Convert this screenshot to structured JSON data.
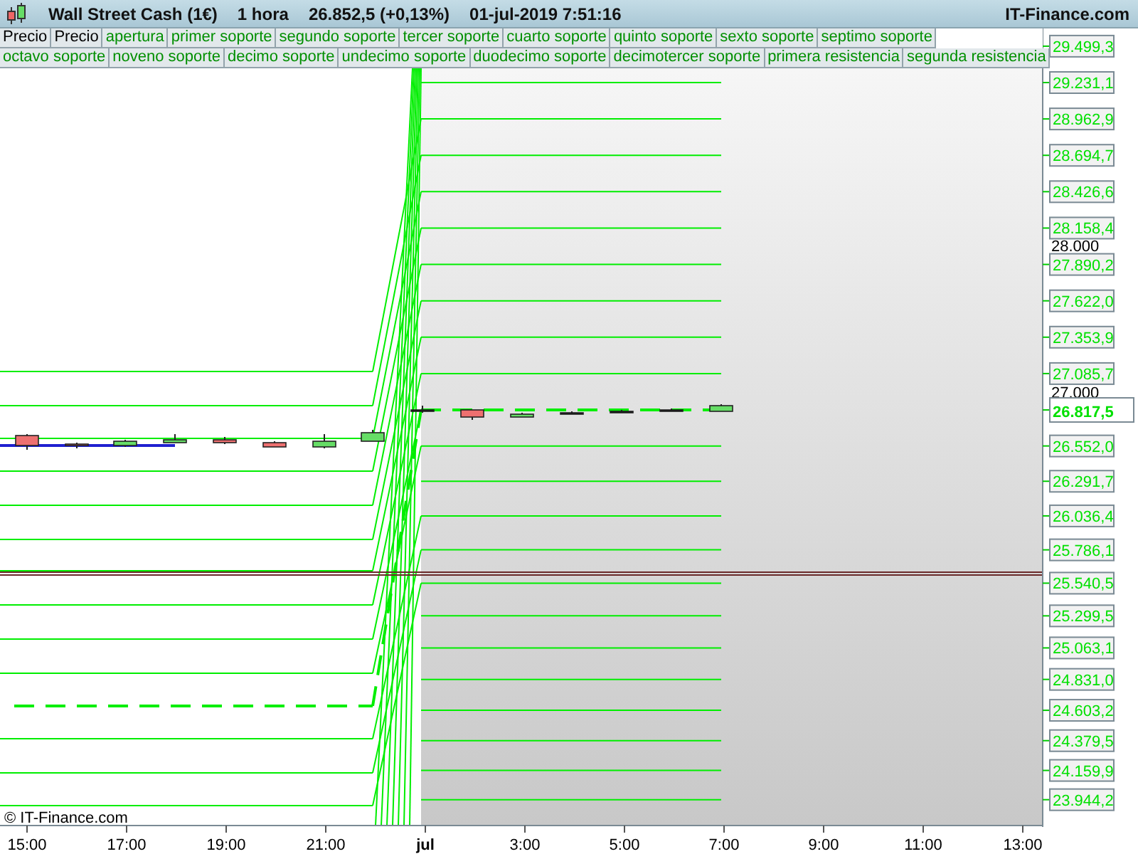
{
  "header": {
    "title": "Wall Street Cash (1€)",
    "interval": "1 hora",
    "quote": "26.852,5 (+0,13%)",
    "datetime": "01-jul-2019 7:51:16",
    "brand": "IT-Finance.com"
  },
  "legend_rows": [
    [
      {
        "label": "Precio",
        "kind": "price"
      },
      {
        "label": "Precio",
        "kind": "price"
      },
      {
        "label": "apertura",
        "kind": "level"
      },
      {
        "label": "primer soporte",
        "kind": "level"
      },
      {
        "label": "segundo soporte",
        "kind": "level"
      },
      {
        "label": "tercer soporte",
        "kind": "level"
      },
      {
        "label": "cuarto soporte",
        "kind": "level"
      },
      {
        "label": "quinto soporte",
        "kind": "level"
      },
      {
        "label": "sexto soporte",
        "kind": "level"
      },
      {
        "label": "septimo soporte",
        "kind": "level"
      }
    ],
    [
      {
        "label": "octavo soporte",
        "kind": "level"
      },
      {
        "label": "noveno soporte",
        "kind": "level"
      },
      {
        "label": "decimo soporte",
        "kind": "level"
      },
      {
        "label": "undecimo soporte",
        "kind": "level"
      },
      {
        "label": "duodecimo soporte",
        "kind": "level"
      },
      {
        "label": "decimotercer soporte",
        "kind": "level"
      },
      {
        "label": "primera resistencia",
        "kind": "level"
      },
      {
        "label": "segunda resistencia",
        "kind": "level"
      }
    ]
  ],
  "chart": {
    "levels": [
      {
        "label": "29.499,3",
        "kind": "level"
      },
      {
        "label": "29.231,1",
        "kind": "level"
      },
      {
        "label": "28.962,9",
        "kind": "level"
      },
      {
        "label": "28.694,7",
        "kind": "level"
      },
      {
        "label": "28.426,6",
        "kind": "level"
      },
      {
        "label": "28.158,4",
        "kind": "level"
      },
      {
        "label": "27.890,2",
        "kind": "level"
      },
      {
        "label": "27.622,0",
        "kind": "level"
      },
      {
        "label": "27.353,9",
        "kind": "level"
      },
      {
        "label": "27.085,7",
        "kind": "level"
      },
      {
        "label": "26.817,5",
        "kind": "price"
      },
      {
        "label": "26.552,0",
        "kind": "level"
      },
      {
        "label": "26.291,7",
        "kind": "level"
      },
      {
        "label": "26.036,4",
        "kind": "level"
      },
      {
        "label": "25.786,1",
        "kind": "level"
      },
      {
        "label": "25.540,5",
        "kind": "level"
      },
      {
        "label": "25.299,5",
        "kind": "level"
      },
      {
        "label": "25.063,1",
        "kind": "level"
      },
      {
        "label": "24.831,0",
        "kind": "level"
      },
      {
        "label": "24.603,2",
        "kind": "level"
      },
      {
        "label": "24.379,5",
        "kind": "level"
      },
      {
        "label": "24.159,9",
        "kind": "level"
      },
      {
        "label": "23.944,2",
        "kind": "level"
      }
    ],
    "grid_labels": [
      "28.000",
      "27.000"
    ],
    "time_labels": [
      {
        "label": "15:00",
        "kind": "hour"
      },
      {
        "label": "17:00",
        "kind": "hour"
      },
      {
        "label": "19:00",
        "kind": "hour"
      },
      {
        "label": "21:00",
        "kind": "hour"
      },
      {
        "label": "jul",
        "kind": "day"
      },
      {
        "label": "3:00",
        "kind": "hour"
      },
      {
        "label": "5:00",
        "kind": "hour"
      },
      {
        "label": "7:00",
        "kind": "hour"
      },
      {
        "label": "9:00",
        "kind": "hour"
      },
      {
        "label": "11:00",
        "kind": "hour"
      },
      {
        "label": "13:00",
        "kind": "hour"
      }
    ],
    "copyright": "© IT-Finance.com"
  }
}
